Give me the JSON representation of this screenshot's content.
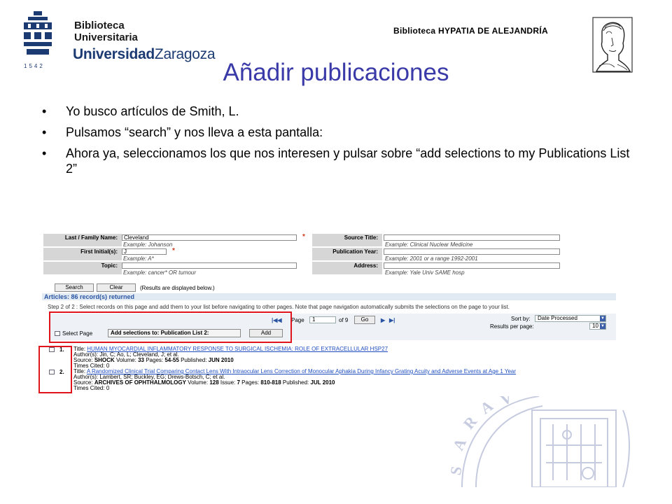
{
  "header": {
    "logo_line1": "Biblioteca",
    "logo_line2": "Universitaria",
    "logo_line3_bold": "Universidad",
    "logo_line3_rest": "Zaragoza",
    "logo_year": "1542",
    "library_name": "Biblioteca HYPATIA DE ALEJANDRÍA",
    "portrait_icon": "hypatia-portrait-icon"
  },
  "slide": {
    "title": "Añadir publicaciones",
    "bullets": [
      "Yo busco artículos de Smith, L.",
      "Pulsamos “search” y nos lleva a esta pantalla:",
      "Ahora ya, seleccionamos los que nos interesen y pulsar sobre “add selections to my Publications List 2”"
    ]
  },
  "search_form": {
    "last_name": {
      "label": "Last / Family Name:",
      "value": "Cleveland",
      "example": "Example: Johanson"
    },
    "first_initial": {
      "label": "First Initial(s):",
      "value": "J",
      "example": "Example: A*"
    },
    "topic": {
      "label": "Topic:",
      "value": "",
      "example": "Example: cancer* OR tumour"
    },
    "source_title": {
      "label": "Source Title:",
      "value": "",
      "example": "Example: Clinical Nuclear Medicine"
    },
    "publication_year": {
      "label": "Publication Year:",
      "value": "",
      "example": "Example: 2001 or a range 1992-2001"
    },
    "address": {
      "label": "Address:",
      "value": "",
      "example": "Example: Yale Univ SAME hosp"
    },
    "search_label": "Search",
    "clear_label": "Clear",
    "results_note": "(Results are displayed below.)"
  },
  "results": {
    "count_bar": "Articles: 86 record(s) returned",
    "step_text": "Step 2 of 2 : Select records on this page and add them to your list before navigating to other pages. Note that page navigation automatically submits the selections on the page to your list.",
    "select_page_label": "Select Page",
    "add_selections_label": "Add selections to: Publication List 2:",
    "add_button": "Add",
    "first_icon": "first-page-icon",
    "prev_icon": "previous-page-icon",
    "page_label": "Page",
    "page_value": "1",
    "of_pages": "of 9",
    "go_button": "Go",
    "next_icon": "next-page-icon",
    "last_icon": "last-page-icon",
    "sort_by_label": "Sort by:",
    "sort_by_value": "Date Processed",
    "per_page_label": "Results per page:",
    "per_page_value": "10",
    "records": [
      {
        "num": "1.",
        "title_label": "Title:",
        "title": "HUMAN MYOCARDIAL INFLAMMATORY RESPONSE TO SURGICAL ISCHEMIA: ROLE OF EXTRACELLULAR HSP27",
        "authors": "Author(s): Jin, C; Ao, L; Cleveland, J; et al.",
        "source_label": "Source:",
        "source": "SHOCK",
        "volume_label": "Volume:",
        "volume": "33",
        "pages_label": "Pages:",
        "pages": "54-55",
        "published_label": "Published:",
        "published": "JUN 2010",
        "cited": "Times Cited: 0"
      },
      {
        "num": "2.",
        "title_label": "Title:",
        "title": "A Randomized Clinical Trial Comparing Contact Lens With Intraocular Lens Correction of Monocular Aphakia During Infancy Grating Acuity and Adverse Events at Age 1 Year",
        "authors": "Author(s): Lambert, SR; Buckley, EG; Drews-Botsch, C; et al.",
        "source_label": "Source:",
        "source": "ARCHIVES OF OPHTHALMOLOGY",
        "volume_label": "Volume:",
        "volume": "128",
        "issue_label": "Issue:",
        "issue": "7",
        "pages_label": "Pages:",
        "pages": "810-818",
        "published_label": "Published:",
        "published": "JUL 2010",
        "cited": "Times Cited: 0"
      }
    ]
  },
  "colors": {
    "title": "#3a3aa8",
    "highlight": "#e0141c",
    "link": "#1f4fc1"
  }
}
